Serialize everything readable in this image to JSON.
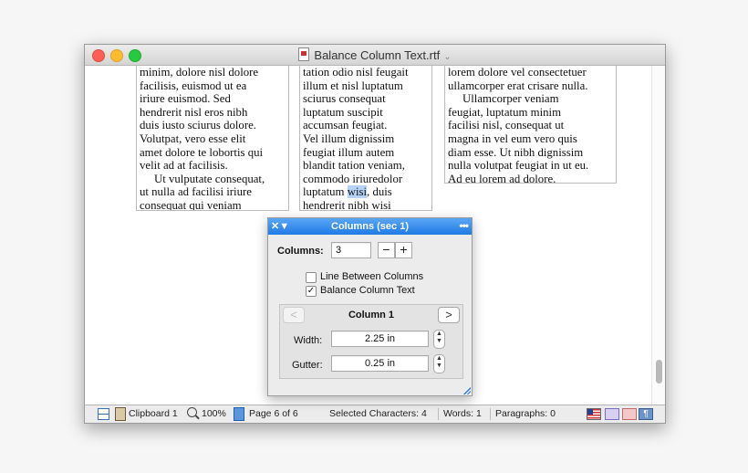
{
  "window": {
    "title": "Balance Column Text.rtf"
  },
  "document": {
    "column1": [
      "minim, dolore nisl dolore",
      "facilisis, euismod ut ea",
      "iriure euismod. Sed",
      "hendrerit nisl eros nibh",
      "duis iusto sciurus dolore.",
      "Volutpat, vero esse elit",
      "amet dolore te lobortis qui",
      "velit ad at facilisis.",
      "     Ut vulputate consequat,",
      "ut nulla ad facilisi iriure",
      "consequat qui veniam"
    ],
    "column2_lines": [
      "tation odio nisl feugait",
      "illum et nisl luptatum",
      "sciurus consequat",
      "luptatum suscipit",
      "accumsan feugiat.",
      "Vel illum dignissim",
      "feugiat illum autem",
      "blandit tation veniam,",
      "commodo iriuredolor"
    ],
    "column2_sel_before": "luptatum ",
    "column2_sel": "wisi",
    "column2_sel_after": ", duis",
    "column2_last": "hendrerit nibh wisi",
    "column3": [
      "lorem dolore vel consectetuer",
      "ullamcorper erat crisare nulla.",
      "     Ullamcorper veniam",
      "feugiat, luptatum minim",
      "facilisi nisl, consequat ut",
      "magna in vel eum vero quis",
      "diam esse. Ut nibh dignissim",
      "nulla volutpat feugiat in ut eu.",
      "Ad eu lorem ad dolore."
    ]
  },
  "status": {
    "clipboard": "Clipboard 1",
    "zoom": "100%",
    "page": "Page 6 of 6",
    "selected": "Selected Characters: 4",
    "words": "Words: 1",
    "paragraphs": "Paragraphs: 0"
  },
  "panel": {
    "title": "Columns (sec 1)",
    "close_glyph": "✕▼",
    "menu_glyph": "•••",
    "columns_label": "Columns:",
    "columns_value": "3",
    "minus": "−",
    "plus": "+",
    "line_between_label": "Line Between Columns",
    "line_between_checked": false,
    "balance_label": "Balance Column Text",
    "balance_checked": true,
    "column_nav_label": "Column 1",
    "prev_glyph": "<",
    "next_glyph": ">",
    "width_label": "Width:",
    "width_value": "2.25 in",
    "gutter_label": "Gutter:",
    "gutter_value": "0.25 in"
  },
  "icons": {
    "layout": "layout-icon",
    "clipboard": "clipboard-icon",
    "zoom": "magnifier-icon",
    "page": "page-icon",
    "flag": "us-flag-icon",
    "pilcrow": "¶"
  }
}
